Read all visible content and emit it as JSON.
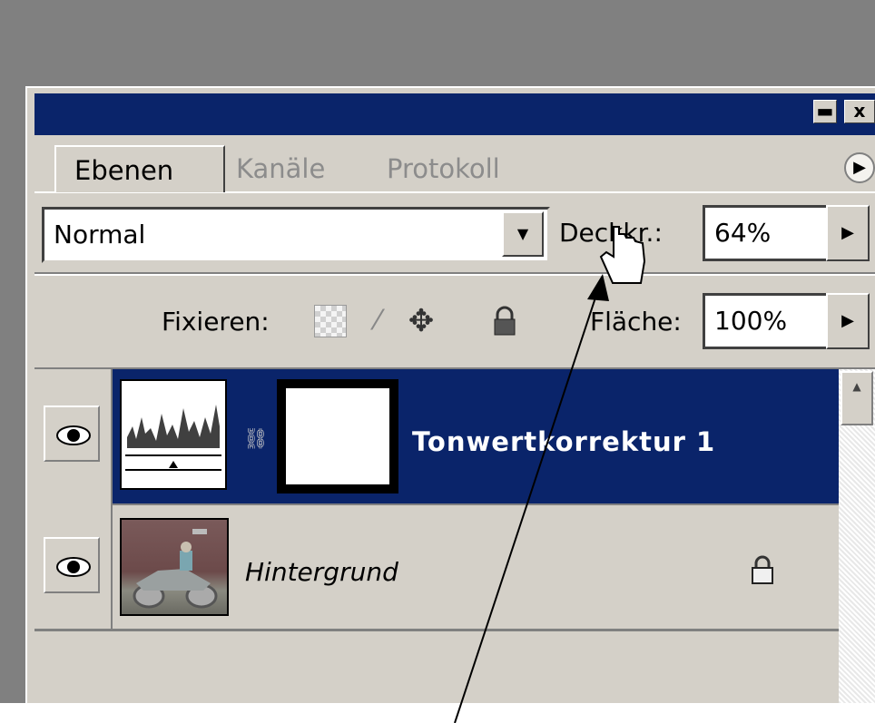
{
  "window": {
    "minimize_label": "▬",
    "close_label": "x"
  },
  "tabs": [
    {
      "label": "Ebenen",
      "active": true
    },
    {
      "label": "Kanäle",
      "active": false
    },
    {
      "label": "Protokoll",
      "active": false
    }
  ],
  "panel_menu_icon": "play-circle-icon",
  "blend_mode": {
    "value": "Normal"
  },
  "opacity": {
    "label": "Deckkr.:",
    "value": "64%"
  },
  "lock": {
    "label": "Fixieren:",
    "icons": [
      "transparency-lock-icon",
      "brush-lock-icon",
      "move-lock-icon",
      "padlock-icon"
    ]
  },
  "fill": {
    "label": "Fläche:",
    "value": "100%"
  },
  "layers": [
    {
      "name": "Tonwertkorrektur 1",
      "type": "adjustment",
      "visible": true,
      "selected": true
    },
    {
      "name": "Hintergrund",
      "type": "image",
      "visible": true,
      "selected": false,
      "locked": true
    }
  ],
  "colors": {
    "title_bar": "#0a246a",
    "panel": "#d4d0c8",
    "selected_row": "#0a246a"
  }
}
